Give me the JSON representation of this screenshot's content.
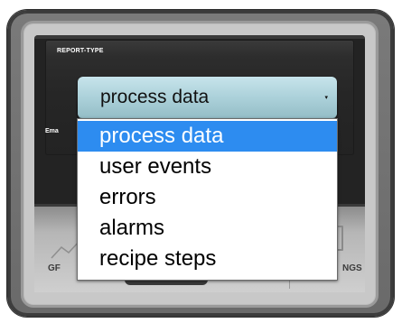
{
  "panel": {
    "title": "REPORT-TYPE",
    "sub_label": "Ema"
  },
  "select": {
    "value": "process data",
    "arrow": "▾"
  },
  "dropdown": {
    "options": [
      {
        "label": "process data",
        "selected": true
      },
      {
        "label": "user events",
        "selected": false
      },
      {
        "label": "errors",
        "selected": false
      },
      {
        "label": "alarms",
        "selected": false
      },
      {
        "label": "recipe steps",
        "selected": false
      }
    ]
  },
  "tabs": {
    "left_label": "GF",
    "right_label": "NGS"
  },
  "colors": {
    "selected_option": "#2d8cf0",
    "select_bg": "#a9cfd8",
    "screen_bg": "#232323",
    "bezel": "#6f6f6f"
  },
  "icons": {
    "chart": "chart-line-icon",
    "settings": "settings-icon",
    "dropdown_arrow": "chevron-down-icon"
  }
}
